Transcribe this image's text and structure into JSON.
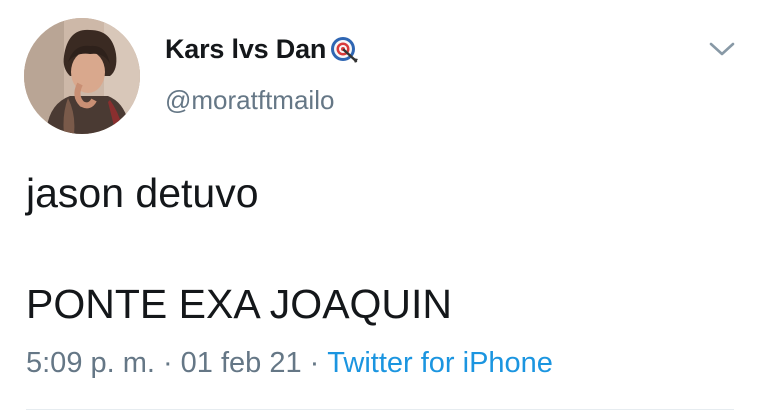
{
  "tweet": {
    "author": {
      "display_name": "Kars lvs Dan",
      "name_emoji_icon": "target-emoji-icon",
      "handle": "@moratftmailo",
      "avatar_icon": "profile-photo"
    },
    "menu_icon": "chevron-down-icon",
    "text_lines": [
      "jason detuvo",
      "PONTE EXA JOAQUIN"
    ],
    "timestamp": "5:09 p. m.",
    "separator": "·",
    "date": "01 feb 21",
    "source": "Twitter for iPhone"
  },
  "colors": {
    "text_primary": "#14171a",
    "text_secondary": "#657786",
    "link": "#1b95e0",
    "divider": "#e6ecf0"
  }
}
